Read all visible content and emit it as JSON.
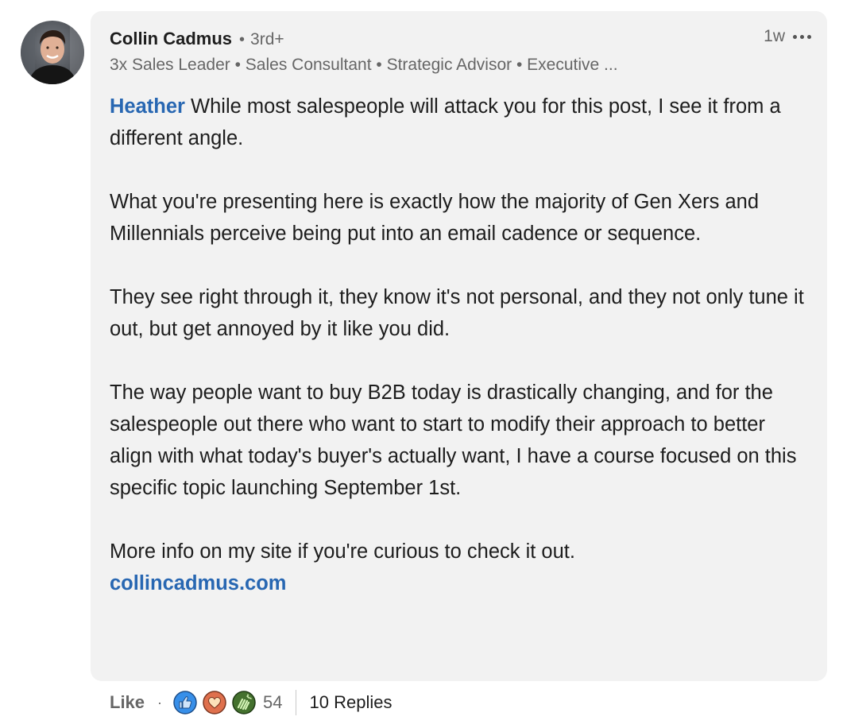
{
  "author": {
    "name": "Collin Cadmus",
    "degree": "3rd+",
    "headline": "3x Sales Leader • Sales Consultant • Strategic Advisor • Executive ...",
    "timestamp": "1w"
  },
  "comment": {
    "mention": "Heather",
    "paragraphs": [
      " While most salespeople will attack you for this post, I see it from a different angle.",
      "What you're presenting here is exactly how the majority of Gen Xers and Millennials perceive being put into an email cadence or sequence.",
      "They see right through it, they know it's not personal, and they not only tune it out, but get annoyed by it like you did.",
      "The way people want to buy B2B today is drastically changing, and for the salespeople out there who want to start to modify their approach to better align with what today's buyer's actually want, I have a course focused on this specific topic launching September 1st.",
      "More info on my site if you're curious to check it out."
    ],
    "link": "collincadmus.com"
  },
  "actions": {
    "like_label": "Like",
    "separator": "·",
    "reaction_count": "54",
    "reaction_icons": [
      "like-icon",
      "love-icon",
      "celebrate-icon"
    ],
    "replies_label": "10 Replies"
  },
  "colors": {
    "link_blue": "#2867b2",
    "bubble_bg": "#f2f2f2",
    "like_blue": "#378fe9",
    "love_red": "#df704d",
    "celebrate_green": "#44712e"
  }
}
